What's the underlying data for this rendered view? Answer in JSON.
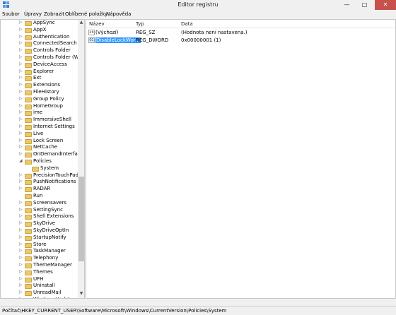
{
  "window": {
    "title": "Editor registru",
    "minimize": "—",
    "maximize": "□",
    "close": "✕"
  },
  "menu": [
    "Soubor",
    "Úpravy",
    "Zobrazit",
    "Oblíbené položky",
    "Nápověda"
  ],
  "tree": [
    {
      "label": "AppSync",
      "expander": "▷",
      "depth": 0
    },
    {
      "label": "AppX",
      "expander": "▷",
      "depth": 0
    },
    {
      "label": "Authentication",
      "expander": "▷",
      "depth": 0
    },
    {
      "label": "ConnectedSearch",
      "expander": "▷",
      "depth": 0
    },
    {
      "label": "Controls Folder",
      "expander": "▷",
      "depth": 0
    },
    {
      "label": "Controls Folder (Wow",
      "expander": "▷",
      "depth": 0
    },
    {
      "label": "DeviceAccess",
      "expander": "▷",
      "depth": 0
    },
    {
      "label": "Explorer",
      "expander": "▷",
      "depth": 0
    },
    {
      "label": "Ext",
      "expander": "▷",
      "depth": 0
    },
    {
      "label": "Extensions",
      "expander": "▷",
      "depth": 0
    },
    {
      "label": "FileHistory",
      "expander": "▷",
      "depth": 0
    },
    {
      "label": "Group Policy",
      "expander": "▷",
      "depth": 0
    },
    {
      "label": "HomeGroup",
      "expander": "▷",
      "depth": 0
    },
    {
      "label": "ime",
      "expander": "▷",
      "depth": 0
    },
    {
      "label": "ImmersiveShell",
      "expander": "▷",
      "depth": 0
    },
    {
      "label": "Internet Settings",
      "expander": "▷",
      "depth": 0
    },
    {
      "label": "Live",
      "expander": "▷",
      "depth": 0
    },
    {
      "label": "Lock Screen",
      "expander": "▷",
      "depth": 0
    },
    {
      "label": "NetCache",
      "expander": "▷",
      "depth": 0
    },
    {
      "label": "OnDemandInterfaceC",
      "expander": "▷",
      "depth": 0
    },
    {
      "label": "Policies",
      "expander": "◢",
      "depth": 0
    },
    {
      "label": "System",
      "expander": "",
      "depth": 1,
      "selected": true
    },
    {
      "label": "PrecisionTouchPad",
      "expander": "▷",
      "depth": 0
    },
    {
      "label": "PushNotifications",
      "expander": "▷",
      "depth": 0
    },
    {
      "label": "RADAR",
      "expander": "▷",
      "depth": 0
    },
    {
      "label": "Run",
      "expander": "",
      "depth": 0
    },
    {
      "label": "Screensavers",
      "expander": "▷",
      "depth": 0
    },
    {
      "label": "SettingSync",
      "expander": "▷",
      "depth": 0
    },
    {
      "label": "Shell Extensions",
      "expander": "▷",
      "depth": 0
    },
    {
      "label": "SkyDrive",
      "expander": "▷",
      "depth": 0
    },
    {
      "label": "SkyDriveOptIn",
      "expander": "▷",
      "depth": 0
    },
    {
      "label": "StartupNotify",
      "expander": "▷",
      "depth": 0
    },
    {
      "label": "Store",
      "expander": "▷",
      "depth": 0
    },
    {
      "label": "TaskManager",
      "expander": "▷",
      "depth": 0
    },
    {
      "label": "Telephony",
      "expander": "▷",
      "depth": 0
    },
    {
      "label": "ThemeManager",
      "expander": "▷",
      "depth": 0
    },
    {
      "label": "Themes",
      "expander": "▷",
      "depth": 0
    },
    {
      "label": "UFH",
      "expander": "▷",
      "depth": 0
    },
    {
      "label": "Uninstall",
      "expander": "▷",
      "depth": 0
    },
    {
      "label": "UnreadMail",
      "expander": "▷",
      "depth": 0
    },
    {
      "label": "WindowsUpdate",
      "expander": "▷",
      "depth": 0
    }
  ],
  "columns": {
    "name": "Název",
    "type": "Typ",
    "data": "Data"
  },
  "values": [
    {
      "icon": "ab",
      "icon_kind": "string-value-icon",
      "name": "(Výchozí)",
      "type": "REG_SZ",
      "data": "(Hodnota není nastavena.)",
      "selected": false
    },
    {
      "icon": "01",
      "icon_kind": "binary-value-icon",
      "name": "DisableLockWor...",
      "type": "REG_DWORD",
      "data": "0x00000001 (1)",
      "selected": true
    }
  ],
  "status": "Počítač\\HKEY_CURRENT_USER\\Software\\Microsoft\\Windows\\CurrentVersion\\Policies\\System",
  "colors": {
    "selection": "#3399ff",
    "close_button": "#c7514b",
    "folder": "#eac86b"
  }
}
